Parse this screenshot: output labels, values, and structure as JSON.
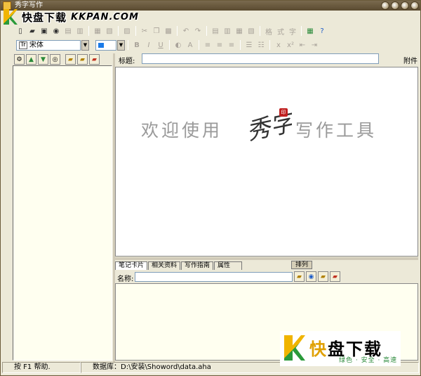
{
  "window": {
    "title": "秀字写作"
  },
  "watermark": {
    "brand": "快盘下载",
    "site": "KKPAN.COM",
    "logo_big_1": "快",
    "logo_big_2": "盘下载",
    "logo_tagline": "绿色 · 安全 · 高速"
  },
  "toolbar": {
    "font_name": "宋体",
    "font_icon": "Tr",
    "bold": "B",
    "italic": "I",
    "underline": "U",
    "font_color": "A"
  },
  "editor": {
    "subject_label": "标题:",
    "attach_label": "附件",
    "welcome_left": "欢迎使用",
    "welcome_right": "写作工具",
    "calligraphy": "秀字",
    "seal": "印"
  },
  "bottom": {
    "tabs": [
      {
        "label": "笔记卡片"
      },
      {
        "label": "相关资料"
      },
      {
        "label": "写作指南"
      },
      {
        "label": "属性"
      }
    ],
    "sort_label": "排列",
    "name_label": "名称:"
  },
  "status": {
    "help": "按 F1 帮助.",
    "database": "数据库：D:\\安装\\Showord\\data.aha"
  },
  "colors": {
    "panel_bg": "#fffff0",
    "accent_blue": "#1a7ae8"
  }
}
